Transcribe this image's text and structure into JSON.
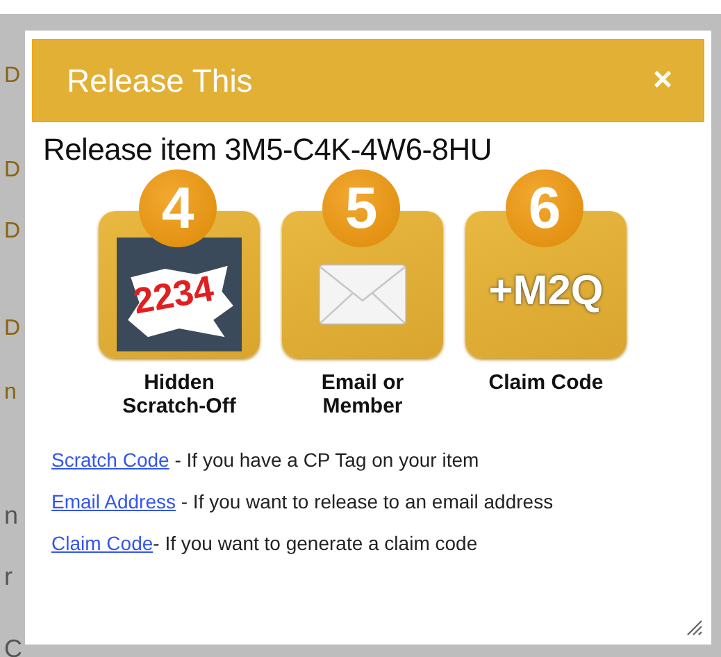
{
  "backdrop": {
    "fragments": [
      "D",
      "D",
      "D",
      "D",
      "n",
      "n",
      "r",
      "C"
    ]
  },
  "dialog": {
    "title": "Release This",
    "close": "×",
    "heading": "Release item 3M5-C4K-4W6-8HU",
    "options": [
      {
        "kind": "scratch",
        "number": "4",
        "art_text": "2234",
        "label": "Hidden Scratch-Off"
      },
      {
        "kind": "email",
        "number": "5",
        "label": "Email or Member"
      },
      {
        "kind": "code",
        "number": "6",
        "art_text": "+M2Q",
        "label": "Claim Code"
      }
    ],
    "links": [
      {
        "link": "Scratch Code",
        "text": " - If you have a CP Tag on your item"
      },
      {
        "link": "Email Address",
        "text": " - If you want to release to an email address"
      },
      {
        "link": "Claim Code",
        "text": "- If you want to generate a claim code"
      }
    ]
  }
}
